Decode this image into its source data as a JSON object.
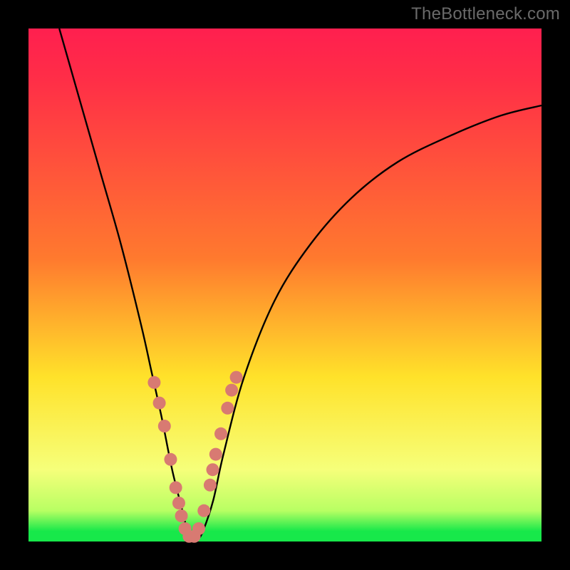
{
  "watermark": "TheBottleneck.com",
  "colors": {
    "top": "#ff1f4f",
    "red": "#ff2e47",
    "orange": "#ff7a2e",
    "yellow": "#ffe22a",
    "paleyellow": "#f6ff7a",
    "limepale": "#b8ff63",
    "green": "#17e84a",
    "dot": "#d87a72",
    "curve": "#000000"
  },
  "chart_data": {
    "type": "line",
    "title": "",
    "xlabel": "",
    "ylabel": "",
    "xlim": [
      0,
      100
    ],
    "ylim": [
      0,
      100
    ],
    "series": [
      {
        "name": "bottleneck-curve",
        "x": [
          6,
          10,
          14,
          18,
          22,
          24,
          26,
          28,
          30,
          31,
          32,
          33,
          34,
          36,
          38,
          42,
          48,
          55,
          63,
          72,
          82,
          92,
          100
        ],
        "y": [
          100,
          86,
          72,
          58,
          42,
          33,
          24,
          14,
          6,
          2,
          0.5,
          0.5,
          2,
          8,
          17,
          32,
          47,
          58,
          67,
          74,
          79,
          83,
          85
        ]
      }
    ],
    "markers": {
      "name": "highlight-dots",
      "x": [
        24.5,
        25.5,
        26.5,
        27.7,
        28.7,
        29.3,
        29.8,
        30.5,
        31.3,
        32.3,
        33.2,
        34.2,
        35.4,
        35.9,
        36.5,
        37.5,
        38.8,
        39.6,
        40.5
      ],
      "y": [
        31,
        27,
        22.5,
        16,
        10.5,
        7.5,
        5,
        2.5,
        1,
        1,
        2.5,
        6,
        11,
        14,
        17,
        21,
        26,
        29.5,
        32
      ]
    }
  }
}
